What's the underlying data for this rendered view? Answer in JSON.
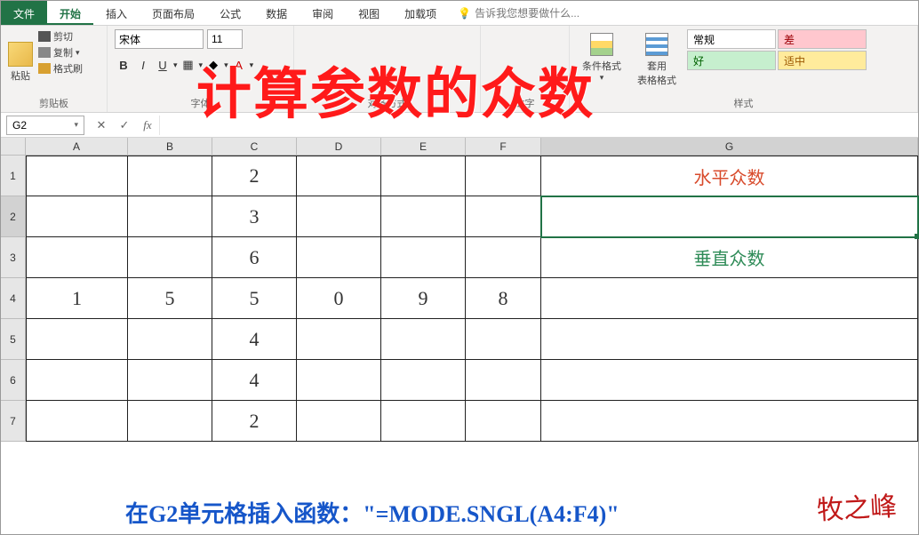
{
  "tabs": {
    "file": "文件",
    "home": "开始",
    "insert": "插入",
    "layout": "页面布局",
    "formulas": "公式",
    "data": "数据",
    "review": "审阅",
    "view": "视图",
    "addins": "加载项",
    "tellme": "告诉我您想要做什么..."
  },
  "ribbon": {
    "clipboard": {
      "label": "剪贴板",
      "paste": "粘贴",
      "cut": "剪切",
      "copy": "复制",
      "painter": "格式刷"
    },
    "font": {
      "label": "字体",
      "family": "宋体",
      "size": "11",
      "bold": "B",
      "italic": "I",
      "underline": "U"
    },
    "align": {
      "label": "对齐方式"
    },
    "number": {
      "label": "数字"
    },
    "cond": "条件格式",
    "tablefmt1": "套用",
    "tablefmt2": "表格格式",
    "styles": {
      "label": "样式",
      "normal": "常规",
      "bad": "差",
      "good": "好",
      "neutral": "适中"
    }
  },
  "overlay_title": "计算参数的众数",
  "namebox": "G2",
  "fx": {
    "cancel": "✕",
    "enter": "✓",
    "fx": "fx"
  },
  "columns": [
    "A",
    "B",
    "C",
    "D",
    "E",
    "F",
    "G"
  ],
  "rownums": [
    "1",
    "2",
    "3",
    "4",
    "5",
    "6",
    "7"
  ],
  "cells": {
    "C1": "2",
    "G1": "水平众数",
    "C2": "3",
    "C3": "6",
    "G3": "垂直众数",
    "A4": "1",
    "B4": "5",
    "C4": "5",
    "D4": "0",
    "E4": "9",
    "F4": "8",
    "C5": "4",
    "C6": "4",
    "C7": "2"
  },
  "caption": "在G2单元格插入函数：\"=MODE.SNGL(A4:F4)\"",
  "signature": "牧之峰"
}
